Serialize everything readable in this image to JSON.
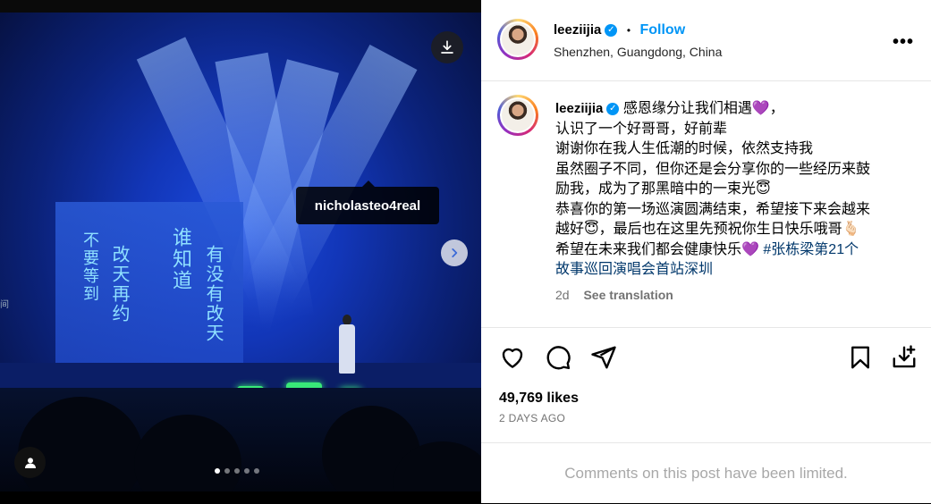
{
  "post": {
    "media": {
      "tag_label": "nicholasteo4real",
      "screen_text_left_1": "不要等到",
      "screen_text_left_2": "改天再约",
      "screen_text_right_1": "谁知道",
      "screen_text_right_2": "有没有改天",
      "side_label": "间",
      "carousel_count": 5,
      "carousel_active_index": 0,
      "download_icon": "download-icon",
      "next_icon": "chevron-right-icon",
      "user_tag_icon": "user-icon"
    },
    "header": {
      "username": "leeziijia",
      "separator": "•",
      "follow_label": "Follow",
      "location": "Shenzhen, Guangdong, China",
      "more_icon": "more-horizontal-icon",
      "more_label": "•••"
    },
    "caption": {
      "username": "leeziijia",
      "lines": [
        "感恩缘分让我们相遇💜，",
        "认识了一个好哥哥，好前辈",
        "谢谢你在我人生低潮的时候，依然支持我",
        "虽然圈子不同，但你还是会分享你的一些经历来鼓",
        "励我，成为了那黑暗中的一束光😇",
        "恭喜你的第一场巡演圆满结束，希望接下来会越来",
        "越好😇，最后也在这里先预祝你生日快乐哦哥🫰🏻",
        "希望在未来我们都会健康快乐💜"
      ],
      "hashtag_line1": "#张栋梁第21个",
      "hashtag_line2": "故事巡回演唱会首站深圳",
      "age": "2d",
      "see_translation": "See translation"
    },
    "actions": {
      "like_icon": "heart-icon",
      "comment_icon": "comment-icon",
      "share_icon": "send-icon",
      "save_icon": "bookmark-icon",
      "save_to_icon": "download-tray-icon"
    },
    "likes": "49,769 likes",
    "posted": "2 DAYS AGO",
    "comments_notice": "Comments on this post have been limited.",
    "colors": {
      "link_blue": "#0095f6",
      "hashtag": "#00376b",
      "muted": "#737373"
    }
  }
}
